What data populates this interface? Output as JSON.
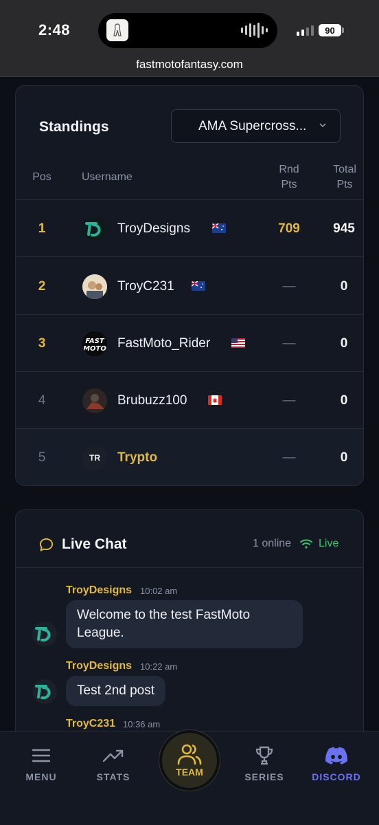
{
  "status_bar": {
    "time": "2:48",
    "battery": "90"
  },
  "browser": {
    "url": "fastmotofantasy.com"
  },
  "standings": {
    "title": "Standings",
    "series_selected": "AMA Supercross...",
    "columns": {
      "pos": "Pos",
      "username": "Username",
      "rnd_pts": [
        "Rnd",
        "Pts"
      ],
      "total_pts": [
        "Total",
        "Pts"
      ]
    },
    "rows": [
      {
        "pos": "1",
        "username": "TroyDesigns",
        "rnd": "709",
        "total": "945"
      },
      {
        "pos": "2",
        "username": "TroyC231",
        "rnd": "—",
        "total": "0"
      },
      {
        "pos": "3",
        "username": "FastMoto_Rider",
        "rnd": "—",
        "total": "0"
      },
      {
        "pos": "4",
        "username": "Brubuzz100",
        "rnd": "—",
        "total": "0"
      },
      {
        "pos": "5",
        "username": "Trypto",
        "avatar_initials": "TR",
        "rnd": "—",
        "total": "0"
      }
    ]
  },
  "chat": {
    "title": "Live Chat",
    "online": "1 online",
    "live": "Live",
    "messages": [
      {
        "author": "TroyDesigns",
        "time": "10:02 am",
        "text": "Welcome to the test FastMoto League."
      },
      {
        "author": "TroyDesigns",
        "time": "10:22 am",
        "text": "Test 2nd post"
      },
      {
        "author": "TroyC231",
        "time": "10:36 am",
        "text": ""
      }
    ]
  },
  "nav": {
    "menu": "MENU",
    "stats": "STATS",
    "team": "TEAM",
    "series": "SERIES",
    "discord": "DISCORD"
  },
  "colors": {
    "accent_gold": "#e2b93b",
    "discord": "#6b72f0",
    "live_green": "#3ec46d",
    "card_bg": "#131823"
  }
}
